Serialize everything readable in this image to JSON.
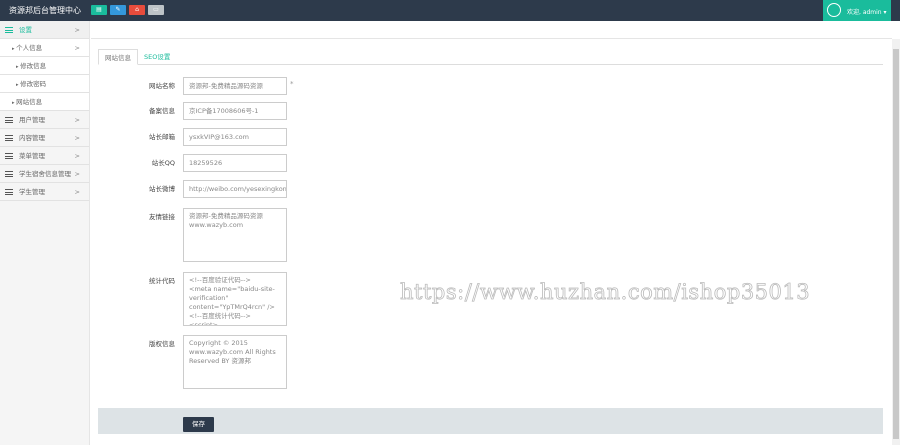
{
  "header": {
    "title": "资源邦后台管理中心",
    "quick_buttons": [
      {
        "icon": "list-icon",
        "color": "#1abc9c",
        "glyph": "▤"
      },
      {
        "icon": "pencil-icon",
        "color": "#3498db",
        "glyph": "✎"
      },
      {
        "icon": "home-icon",
        "color": "#e74c3c",
        "glyph": "⌂"
      },
      {
        "icon": "card-icon",
        "color": "#bdc3c7",
        "glyph": "▭"
      }
    ],
    "user": "欢迎, admin ▾"
  },
  "sidebar": {
    "items": [
      {
        "label": "设置",
        "type": "active",
        "chevron": ">"
      },
      {
        "label": "个人信息",
        "type": "sub",
        "chevron": ">"
      },
      {
        "label": "修改信息",
        "type": "sub2"
      },
      {
        "label": "修改密码",
        "type": "sub2"
      },
      {
        "label": "网站信息",
        "type": "sub"
      },
      {
        "label": "用户管理",
        "type": "main",
        "chevron": ">"
      },
      {
        "label": "内容管理",
        "type": "main",
        "chevron": ">"
      },
      {
        "label": "菜单管理",
        "type": "main",
        "chevron": ">"
      },
      {
        "label": "学生宿舍信息管理",
        "type": "main",
        "chevron": ">"
      },
      {
        "label": "学生管理",
        "type": "main",
        "chevron": ">"
      }
    ]
  },
  "tabs": [
    "网站信息",
    "SEO设置"
  ],
  "form": {
    "fields": [
      {
        "label": "网站名称",
        "value": "资源邦-免费精品源码资源",
        "required": "*"
      },
      {
        "label": "备案信息",
        "value": "京ICP备17008606号-1"
      },
      {
        "label": "站长邮箱",
        "value": "ysxkVIP@163.com"
      },
      {
        "label": "站长QQ",
        "value": "18259526"
      },
      {
        "label": "站长微博",
        "value": "http://weibo.com/yesexingkon"
      }
    ],
    "textareas": [
      {
        "label": "友情链接",
        "value": "资源邦-免费精品源码资源\nwww.wazyb.com"
      },
      {
        "label": "统计代码",
        "value": "<!--百度验证代码-->\n<meta name=\"baidu-site-verification\" content=\"YpTMrQ4rcn\" />\n<!--百度统计代码-->\n<script>"
      },
      {
        "label": "版权信息",
        "value": "Copyright © 2015\nwww.wazyb.com All Rights Reserved BY 资源邦"
      }
    ],
    "save": "保存"
  },
  "watermark": "https://www.huzhan.com/ishop35013"
}
